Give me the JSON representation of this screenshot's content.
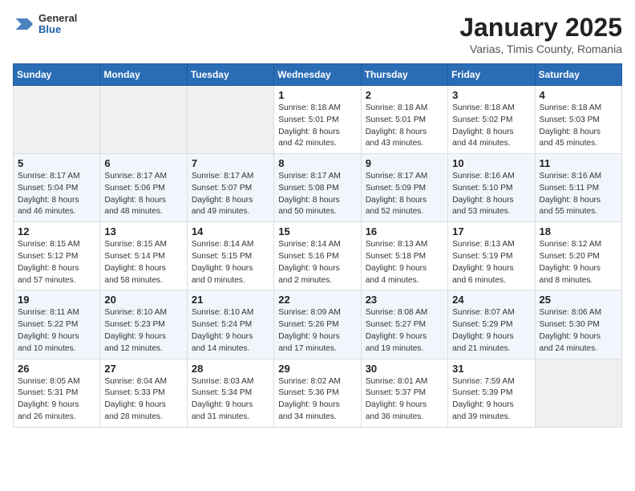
{
  "header": {
    "logo_general": "General",
    "logo_blue": "Blue",
    "month_title": "January 2025",
    "subtitle": "Varias, Timis County, Romania"
  },
  "calendar": {
    "days_of_week": [
      "Sunday",
      "Monday",
      "Tuesday",
      "Wednesday",
      "Thursday",
      "Friday",
      "Saturday"
    ],
    "weeks": [
      [
        {
          "day": "",
          "info": ""
        },
        {
          "day": "",
          "info": ""
        },
        {
          "day": "",
          "info": ""
        },
        {
          "day": "1",
          "info": "Sunrise: 8:18 AM\nSunset: 5:01 PM\nDaylight: 8 hours\nand 42 minutes."
        },
        {
          "day": "2",
          "info": "Sunrise: 8:18 AM\nSunset: 5:01 PM\nDaylight: 8 hours\nand 43 minutes."
        },
        {
          "day": "3",
          "info": "Sunrise: 8:18 AM\nSunset: 5:02 PM\nDaylight: 8 hours\nand 44 minutes."
        },
        {
          "day": "4",
          "info": "Sunrise: 8:18 AM\nSunset: 5:03 PM\nDaylight: 8 hours\nand 45 minutes."
        }
      ],
      [
        {
          "day": "5",
          "info": "Sunrise: 8:17 AM\nSunset: 5:04 PM\nDaylight: 8 hours\nand 46 minutes."
        },
        {
          "day": "6",
          "info": "Sunrise: 8:17 AM\nSunset: 5:06 PM\nDaylight: 8 hours\nand 48 minutes."
        },
        {
          "day": "7",
          "info": "Sunrise: 8:17 AM\nSunset: 5:07 PM\nDaylight: 8 hours\nand 49 minutes."
        },
        {
          "day": "8",
          "info": "Sunrise: 8:17 AM\nSunset: 5:08 PM\nDaylight: 8 hours\nand 50 minutes."
        },
        {
          "day": "9",
          "info": "Sunrise: 8:17 AM\nSunset: 5:09 PM\nDaylight: 8 hours\nand 52 minutes."
        },
        {
          "day": "10",
          "info": "Sunrise: 8:16 AM\nSunset: 5:10 PM\nDaylight: 8 hours\nand 53 minutes."
        },
        {
          "day": "11",
          "info": "Sunrise: 8:16 AM\nSunset: 5:11 PM\nDaylight: 8 hours\nand 55 minutes."
        }
      ],
      [
        {
          "day": "12",
          "info": "Sunrise: 8:15 AM\nSunset: 5:12 PM\nDaylight: 8 hours\nand 57 minutes."
        },
        {
          "day": "13",
          "info": "Sunrise: 8:15 AM\nSunset: 5:14 PM\nDaylight: 8 hours\nand 58 minutes."
        },
        {
          "day": "14",
          "info": "Sunrise: 8:14 AM\nSunset: 5:15 PM\nDaylight: 9 hours\nand 0 minutes."
        },
        {
          "day": "15",
          "info": "Sunrise: 8:14 AM\nSunset: 5:16 PM\nDaylight: 9 hours\nand 2 minutes."
        },
        {
          "day": "16",
          "info": "Sunrise: 8:13 AM\nSunset: 5:18 PM\nDaylight: 9 hours\nand 4 minutes."
        },
        {
          "day": "17",
          "info": "Sunrise: 8:13 AM\nSunset: 5:19 PM\nDaylight: 9 hours\nand 6 minutes."
        },
        {
          "day": "18",
          "info": "Sunrise: 8:12 AM\nSunset: 5:20 PM\nDaylight: 9 hours\nand 8 minutes."
        }
      ],
      [
        {
          "day": "19",
          "info": "Sunrise: 8:11 AM\nSunset: 5:22 PM\nDaylight: 9 hours\nand 10 minutes."
        },
        {
          "day": "20",
          "info": "Sunrise: 8:10 AM\nSunset: 5:23 PM\nDaylight: 9 hours\nand 12 minutes."
        },
        {
          "day": "21",
          "info": "Sunrise: 8:10 AM\nSunset: 5:24 PM\nDaylight: 9 hours\nand 14 minutes."
        },
        {
          "day": "22",
          "info": "Sunrise: 8:09 AM\nSunset: 5:26 PM\nDaylight: 9 hours\nand 17 minutes."
        },
        {
          "day": "23",
          "info": "Sunrise: 8:08 AM\nSunset: 5:27 PM\nDaylight: 9 hours\nand 19 minutes."
        },
        {
          "day": "24",
          "info": "Sunrise: 8:07 AM\nSunset: 5:29 PM\nDaylight: 9 hours\nand 21 minutes."
        },
        {
          "day": "25",
          "info": "Sunrise: 8:06 AM\nSunset: 5:30 PM\nDaylight: 9 hours\nand 24 minutes."
        }
      ],
      [
        {
          "day": "26",
          "info": "Sunrise: 8:05 AM\nSunset: 5:31 PM\nDaylight: 9 hours\nand 26 minutes."
        },
        {
          "day": "27",
          "info": "Sunrise: 8:04 AM\nSunset: 5:33 PM\nDaylight: 9 hours\nand 28 minutes."
        },
        {
          "day": "28",
          "info": "Sunrise: 8:03 AM\nSunset: 5:34 PM\nDaylight: 9 hours\nand 31 minutes."
        },
        {
          "day": "29",
          "info": "Sunrise: 8:02 AM\nSunset: 5:36 PM\nDaylight: 9 hours\nand 34 minutes."
        },
        {
          "day": "30",
          "info": "Sunrise: 8:01 AM\nSunset: 5:37 PM\nDaylight: 9 hours\nand 36 minutes."
        },
        {
          "day": "31",
          "info": "Sunrise: 7:59 AM\nSunset: 5:39 PM\nDaylight: 9 hours\nand 39 minutes."
        },
        {
          "day": "",
          "info": ""
        }
      ]
    ]
  }
}
